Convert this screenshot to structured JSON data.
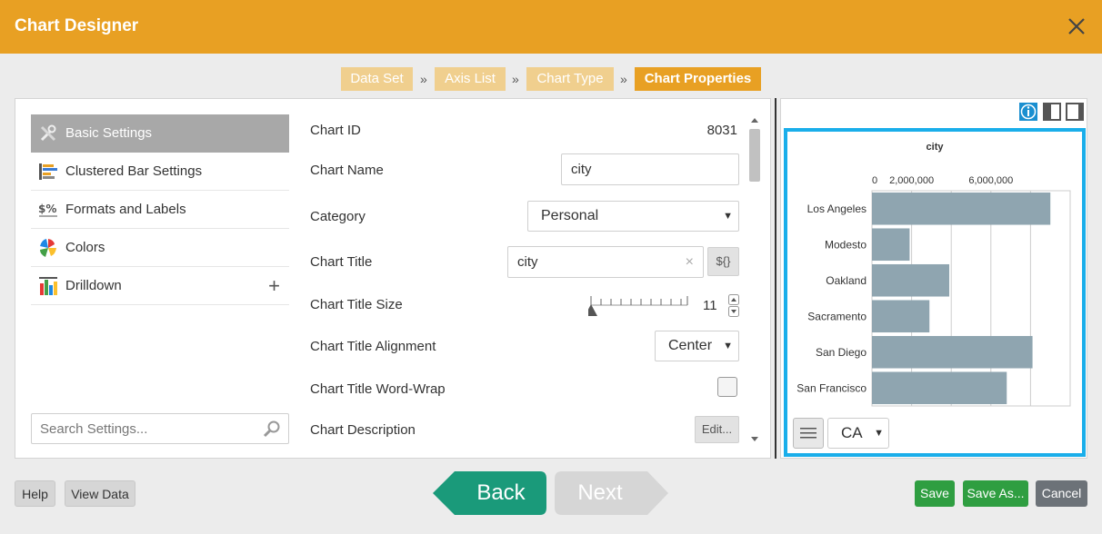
{
  "window": {
    "title": "Chart Designer"
  },
  "wizard": {
    "steps": [
      "Data Set",
      "Axis List",
      "Chart Type",
      "Chart Properties"
    ],
    "separator": "»",
    "active_index": 3
  },
  "settings_menu": {
    "items": [
      {
        "label": "Basic Settings",
        "icon": "tools-icon",
        "selected": true
      },
      {
        "label": "Clustered Bar Settings",
        "icon": "bar-chart-icon",
        "selected": false
      },
      {
        "label": "Formats and Labels",
        "icon": "dollar-percent-icon",
        "selected": false
      },
      {
        "label": "Colors",
        "icon": "color-wheel-icon",
        "selected": false
      },
      {
        "label": "Drilldown",
        "icon": "drilldown-icon",
        "selected": false,
        "expand": "+"
      }
    ],
    "search_placeholder": "Search Settings..."
  },
  "properties": {
    "chart_id": {
      "label": "Chart ID",
      "value": "8031"
    },
    "chart_name": {
      "label": "Chart Name",
      "value": "city"
    },
    "category": {
      "label": "Category",
      "value": "Personal"
    },
    "chart_title": {
      "label": "Chart Title",
      "value": "city",
      "clear": "×",
      "expr_button": "${}"
    },
    "chart_title_size": {
      "label": "Chart Title Size",
      "value": "11"
    },
    "chart_title_alignment": {
      "label": "Chart Title Alignment",
      "value": "Center"
    },
    "chart_title_word_wrap": {
      "label": "Chart Title Word-Wrap",
      "checked": false
    },
    "chart_description": {
      "label": "Chart Description",
      "button": "Edit..."
    }
  },
  "preview": {
    "filter_value": "CA"
  },
  "chart_data": {
    "type": "bar",
    "orientation": "horizontal",
    "title": "city",
    "categories": [
      "Los Angeles",
      "Modesto",
      "Oakland",
      "Sacramento",
      "San Diego",
      "San Francisco"
    ],
    "values": [
      9000000,
      1900000,
      3900000,
      2900000,
      8100000,
      6800000
    ],
    "x_ticks": [
      "0",
      "2,000,000",
      "6,000,000"
    ],
    "x_tick_values": [
      0,
      2000000,
      6000000
    ],
    "xlim": [
      0,
      10000000
    ],
    "grid": true,
    "bar_color": "#8fa5b0"
  },
  "footer": {
    "help": "Help",
    "view_data": "View Data",
    "back": "Back",
    "next": "Next",
    "save": "Save",
    "save_as": "Save As...",
    "cancel": "Cancel"
  },
  "colors": {
    "accent": "#e8a023",
    "accent_light": "#f0cf8e",
    "back": "#1a9a7a",
    "next_disabled": "#d4d4d4",
    "save": "#2f9e41",
    "frame": "#1aaeea"
  }
}
